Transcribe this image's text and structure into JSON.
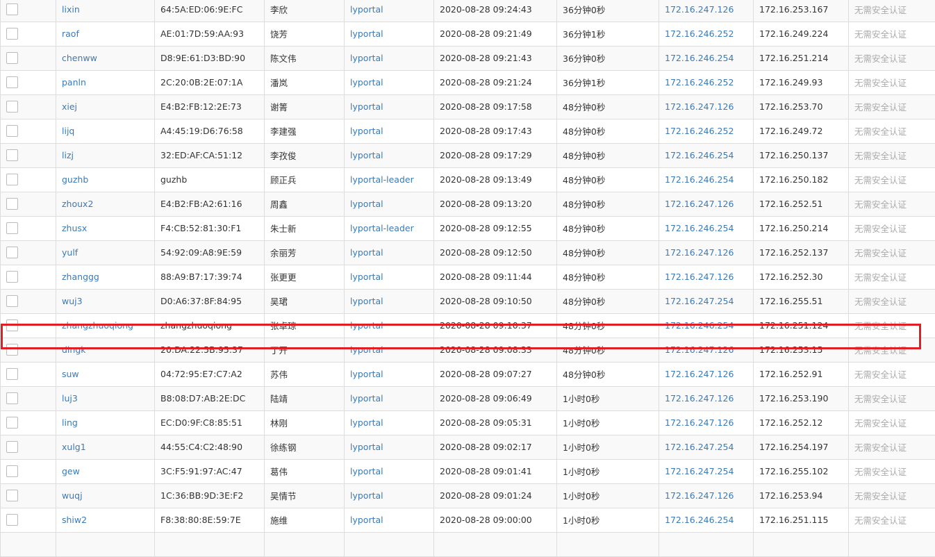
{
  "colors": {
    "link": "#3a7ab8",
    "muted": "#aaaaaa",
    "highlight": "#e01e24",
    "border": "#dddddd"
  },
  "highlighted_row_index": 13,
  "rows": [
    {
      "user": "lixin",
      "mac": "64:5A:ED:06:9E:FC",
      "name": "李欣",
      "group": "lyportal",
      "time": "2020-08-28 09:24:43",
      "duration": "36分钟0秒",
      "nas_ip": "172.16.247.126",
      "client_ip": "172.16.253.167",
      "auth": "无需安全认证"
    },
    {
      "user": "raof",
      "mac": "AE:01:7D:59:AA:93",
      "name": "饶芳",
      "group": "lyportal",
      "time": "2020-08-28 09:21:49",
      "duration": "36分钟1秒",
      "nas_ip": "172.16.246.252",
      "client_ip": "172.16.249.224",
      "auth": "无需安全认证"
    },
    {
      "user": "chenww",
      "mac": "D8:9E:61:D3:BD:90",
      "name": "陈文伟",
      "group": "lyportal",
      "time": "2020-08-28 09:21:43",
      "duration": "36分钟0秒",
      "nas_ip": "172.16.246.254",
      "client_ip": "172.16.251.214",
      "auth": "无需安全认证"
    },
    {
      "user": "panln",
      "mac": "2C:20:0B:2E:07:1A",
      "name": "潘岚",
      "group": "lyportal",
      "time": "2020-08-28 09:21:24",
      "duration": "36分钟1秒",
      "nas_ip": "172.16.246.252",
      "client_ip": "172.16.249.93",
      "auth": "无需安全认证"
    },
    {
      "user": "xiej",
      "mac": "E4:B2:FB:12:2E:73",
      "name": "谢箐",
      "group": "lyportal",
      "time": "2020-08-28 09:17:58",
      "duration": "48分钟0秒",
      "nas_ip": "172.16.247.126",
      "client_ip": "172.16.253.70",
      "auth": "无需安全认证"
    },
    {
      "user": "lijq",
      "mac": "A4:45:19:D6:76:58",
      "name": "李建强",
      "group": "lyportal",
      "time": "2020-08-28 09:17:43",
      "duration": "48分钟0秒",
      "nas_ip": "172.16.246.252",
      "client_ip": "172.16.249.72",
      "auth": "无需安全认证"
    },
    {
      "user": "lizj",
      "mac": "32:ED:AF:CA:51:12",
      "name": "李孜俊",
      "group": "lyportal",
      "time": "2020-08-28 09:17:29",
      "duration": "48分钟0秒",
      "nas_ip": "172.16.246.254",
      "client_ip": "172.16.250.137",
      "auth": "无需安全认证"
    },
    {
      "user": "guzhb",
      "mac": "guzhb",
      "name": "顾正兵",
      "group": "lyportal-leader",
      "time": "2020-08-28 09:13:49",
      "duration": "48分钟0秒",
      "nas_ip": "172.16.246.254",
      "client_ip": "172.16.250.182",
      "auth": "无需安全认证"
    },
    {
      "user": "zhoux2",
      "mac": "E4:B2:FB:A2:61:16",
      "name": "周鑫",
      "group": "lyportal",
      "time": "2020-08-28 09:13:20",
      "duration": "48分钟0秒",
      "nas_ip": "172.16.247.126",
      "client_ip": "172.16.252.51",
      "auth": "无需安全认证"
    },
    {
      "user": "zhusx",
      "mac": "F4:CB:52:81:30:F1",
      "name": "朱士新",
      "group": "lyportal-leader",
      "time": "2020-08-28 09:12:55",
      "duration": "48分钟0秒",
      "nas_ip": "172.16.246.254",
      "client_ip": "172.16.250.214",
      "auth": "无需安全认证"
    },
    {
      "user": "yulf",
      "mac": "54:92:09:A8:9E:59",
      "name": "余丽芳",
      "group": "lyportal",
      "time": "2020-08-28 09:12:50",
      "duration": "48分钟0秒",
      "nas_ip": "172.16.247.126",
      "client_ip": "172.16.252.137",
      "auth": "无需安全认证"
    },
    {
      "user": "zhanggg",
      "mac": "88:A9:B7:17:39:74",
      "name": "张更更",
      "group": "lyportal",
      "time": "2020-08-28 09:11:44",
      "duration": "48分钟0秒",
      "nas_ip": "172.16.247.126",
      "client_ip": "172.16.252.30",
      "auth": "无需安全认证"
    },
    {
      "user": "wuj3",
      "mac": "D0:A6:37:8F:84:95",
      "name": "吴珺",
      "group": "lyportal",
      "time": "2020-08-28 09:10:50",
      "duration": "48分钟0秒",
      "nas_ip": "172.16.247.254",
      "client_ip": "172.16.255.51",
      "auth": "无需安全认证"
    },
    {
      "user": "zhangzhuoqiong",
      "mac": "zhangzhuoqiong",
      "name": "张卓琼",
      "group": "lyportal",
      "time": "2020-08-28 09:10:37",
      "duration": "48分钟0秒",
      "nas_ip": "172.16.246.254",
      "client_ip": "172.16.251.124",
      "auth": "无需安全认证"
    },
    {
      "user": "dingk",
      "mac": "20:DA:22:5B:95:37",
      "name": "丁开",
      "group": "lyportal",
      "time": "2020-08-28 09:08:33",
      "duration": "48分钟0秒",
      "nas_ip": "172.16.247.126",
      "client_ip": "172.16.253.15",
      "auth": "无需安全认证"
    },
    {
      "user": "suw",
      "mac": "04:72:95:E7:C7:A2",
      "name": "苏伟",
      "group": "lyportal",
      "time": "2020-08-28 09:07:27",
      "duration": "48分钟0秒",
      "nas_ip": "172.16.247.126",
      "client_ip": "172.16.252.91",
      "auth": "无需安全认证"
    },
    {
      "user": "luj3",
      "mac": "B8:08:D7:AB:2E:DC",
      "name": "陆靖",
      "group": "lyportal",
      "time": "2020-08-28 09:06:49",
      "duration": "1小时0秒",
      "nas_ip": "172.16.247.126",
      "client_ip": "172.16.253.190",
      "auth": "无需安全认证"
    },
    {
      "user": "ling",
      "mac": "EC:D0:9F:C8:85:51",
      "name": "林刚",
      "group": "lyportal",
      "time": "2020-08-28 09:05:31",
      "duration": "1小时0秒",
      "nas_ip": "172.16.247.126",
      "client_ip": "172.16.252.12",
      "auth": "无需安全认证"
    },
    {
      "user": "xulg1",
      "mac": "44:55:C4:C2:48:90",
      "name": "徐练钢",
      "group": "lyportal",
      "time": "2020-08-28 09:02:17",
      "duration": "1小时0秒",
      "nas_ip": "172.16.247.254",
      "client_ip": "172.16.254.197",
      "auth": "无需安全认证"
    },
    {
      "user": "gew",
      "mac": "3C:F5:91:97:AC:47",
      "name": "葛伟",
      "group": "lyportal",
      "time": "2020-08-28 09:01:41",
      "duration": "1小时0秒",
      "nas_ip": "172.16.247.254",
      "client_ip": "172.16.255.102",
      "auth": "无需安全认证"
    },
    {
      "user": "wuqj",
      "mac": "1C:36:BB:9D:3E:F2",
      "name": "吴情节",
      "group": "lyportal",
      "time": "2020-08-28 09:01:24",
      "duration": "1小时0秒",
      "nas_ip": "172.16.247.126",
      "client_ip": "172.16.253.94",
      "auth": "无需安全认证"
    },
    {
      "user": "shiw2",
      "mac": "F8:38:80:8E:59:7E",
      "name": "施维",
      "group": "lyportal",
      "time": "2020-08-28 09:00:00",
      "duration": "1小时0秒",
      "nas_ip": "172.16.246.254",
      "client_ip": "172.16.251.115",
      "auth": "无需安全认证"
    },
    {
      "user": "",
      "mac": "",
      "name": "",
      "group": "",
      "time": "",
      "duration": "",
      "nas_ip": "",
      "client_ip": "",
      "auth": ""
    }
  ]
}
